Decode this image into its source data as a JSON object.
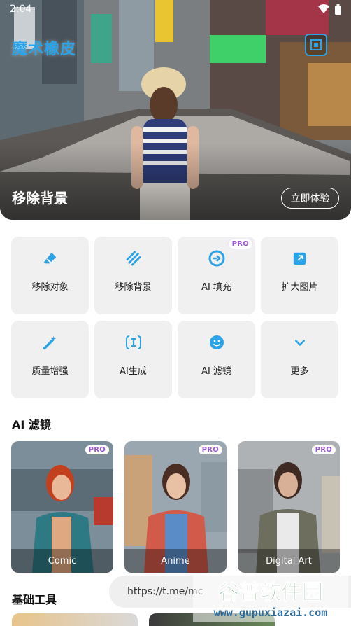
{
  "status_bar": {
    "time": "2:04"
  },
  "hero": {
    "app_title": "魔术橡皮",
    "title": "移除背景",
    "cta": "立即体验"
  },
  "tools": [
    {
      "label": "移除对象",
      "icon": "eraser-icon",
      "pro": false
    },
    {
      "label": "移除背景",
      "icon": "diagonal-stripes-icon",
      "pro": false
    },
    {
      "label": "AI 填充",
      "icon": "refresh-fill-icon",
      "pro": true
    },
    {
      "label": "扩大图片",
      "icon": "expand-image-icon",
      "pro": false
    },
    {
      "label": "质量增强",
      "icon": "magic-wand-icon",
      "pro": false
    },
    {
      "label": "AI生成",
      "icon": "ai-text-icon",
      "pro": false
    },
    {
      "label": "AI 滤镜",
      "icon": "face-sparkle-icon",
      "pro": false
    },
    {
      "label": "更多",
      "icon": "chevron-down-icon",
      "pro": false
    }
  ],
  "pro_label": "PRO",
  "filters_section": {
    "title": "AI 滤镜",
    "items": [
      {
        "name": "Comic",
        "pro": true
      },
      {
        "name": "Anime",
        "pro": true
      },
      {
        "name": "Digital Art",
        "pro": true
      }
    ]
  },
  "basic_tools_section": {
    "title": "基础工具"
  },
  "toast": {
    "text": "https://t.me/mc"
  },
  "watermark": {
    "line1": "谷普软件园",
    "line2": "www.gupuxiazai.com"
  },
  "colors": {
    "accent": "#2aa3e8",
    "pro": "#9b57d6",
    "tile_bg": "#f0f0f0"
  }
}
